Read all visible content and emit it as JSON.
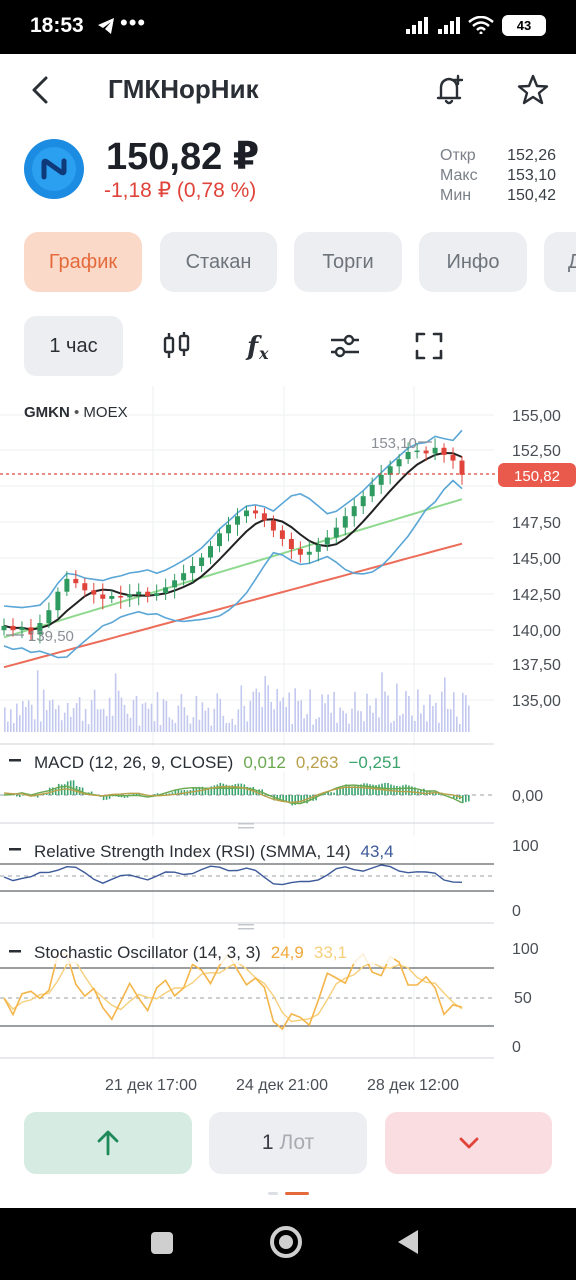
{
  "status_bar": {
    "time": "18:53",
    "more": "•••",
    "battery": "43"
  },
  "header": {
    "title": "ГМКНорНик"
  },
  "quote": {
    "price": "150,82 ₽",
    "change": "-1,18 ₽ (0,78 %)",
    "open_label": "Откр",
    "open": "152,26",
    "high_label": "Макс",
    "high": "153,10",
    "low_label": "Мин",
    "low": "150,42"
  },
  "tabs": [
    "График",
    "Стакан",
    "Торги",
    "Инфо",
    "Д"
  ],
  "toolbar": {
    "interval": "1 час"
  },
  "colors": {
    "accent": "#e46a3b",
    "down": "#e0433a",
    "up": "#1e8a5a",
    "bollinger": "#5aa6d6",
    "ma_fast": "#222222",
    "ma_mid": "#8fd98f",
    "ma_slow": "#ec6d5a",
    "volume": "#c3c8ef",
    "macd": "#6aa84f",
    "signal": "#b8a04a",
    "stochastic": "#f4b54a",
    "rsi": "#3d5a9a"
  },
  "chart": {
    "ticker": "GMKN",
    "exchange": "MOEX",
    "price_labels": [
      "155,00",
      "152,50",
      "147,50",
      "145,00",
      "142,50",
      "140,00",
      "137,50",
      "135,00"
    ],
    "current_price": "150,82",
    "max_marker": "153,10",
    "min_marker": "139,50",
    "macd": {
      "label": "MACD (12, 26, 9, CLOSE)",
      "v1": "0,012",
      "v2": "0,263",
      "v3": "−0,251",
      "axis": "0,00"
    },
    "rsi": {
      "label": "Relative Strength Index (RSI) (SMMA, 14)",
      "value": "43,4",
      "axis_top": "100",
      "axis_bottom": "0"
    },
    "stoch": {
      "label": "Stochastic Oscillator (14, 3, 3)",
      "v1": "24,9",
      "v2": "33,1",
      "axis_top": "100",
      "axis_mid": "50",
      "axis_bottom": "0"
    },
    "time_labels": [
      "21 дек 17:00",
      "24 дек 21:00",
      "28 дек 12:00"
    ]
  },
  "chart_data": {
    "type": "candlestick",
    "ylim": [
      133.5,
      156
    ],
    "series": [
      {
        "name": "close",
        "values": [
          140.2,
          139.9,
          140.1,
          139.6,
          140.4,
          141.3,
          142.6,
          143.5,
          143.2,
          142.7,
          142.4,
          142.1,
          142.3,
          142.2,
          142.4,
          142.6,
          142.3,
          142.5,
          142.9,
          143.4,
          143.9,
          144.4,
          145.0,
          145.8,
          146.7,
          147.3,
          147.9,
          148.3,
          148.1,
          147.6,
          146.9,
          146.3,
          145.6,
          145.2,
          145.4,
          145.9,
          146.4,
          147.1,
          147.9,
          148.6,
          149.3,
          150.1,
          150.8,
          151.4,
          151.9,
          152.4,
          152.5,
          152.3,
          152.7,
          152.2,
          151.8,
          150.8
        ]
      }
    ]
  }
}
